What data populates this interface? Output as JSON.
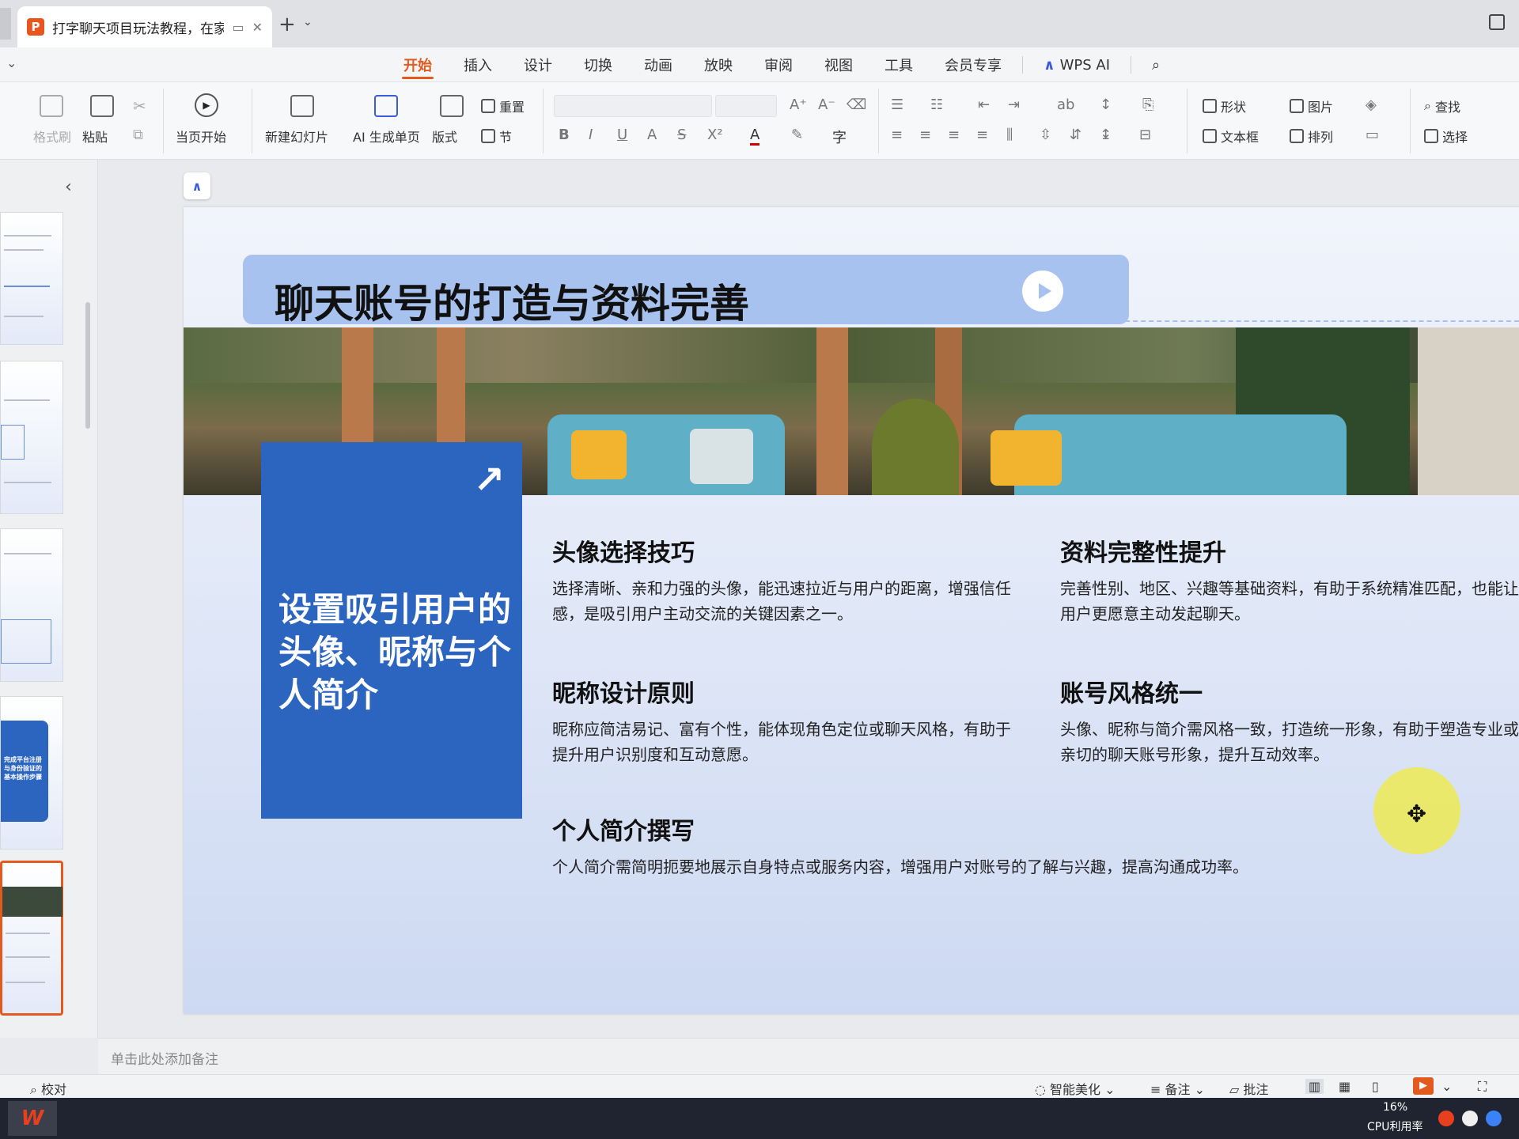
{
  "tabbar": {
    "doc_title": "打字聊天项目玩法教程，在家",
    "app_icon_letter": "P",
    "new_tab": "+"
  },
  "menu": {
    "tabs": [
      "开始",
      "插入",
      "设计",
      "切换",
      "动画",
      "放映",
      "审阅",
      "视图",
      "工具",
      "会员专享",
      "WPS AI"
    ],
    "active": "开始"
  },
  "ribbon": {
    "format_painter": "格式刷",
    "paste": "粘贴",
    "from_current": "当页开始",
    "new_slide": "新建幻灯片",
    "ai_page": "AI 生成单页",
    "layout": "版式",
    "reset": "重置",
    "section": "节",
    "shape": "形状",
    "picture": "图片",
    "textbox": "文本框",
    "arrange": "排列",
    "find": "查找",
    "select": "选择"
  },
  "slide": {
    "title": "聊天账号的打造与资料完善",
    "box_text": "设置吸引用户的头像、昵称与个人简介",
    "sections": [
      {
        "heading": "头像选择技巧",
        "body": "选择清晰、亲和力强的头像，能迅速拉近与用户的距离，增强信任感，是吸引用户主动交流的关键因素之一。"
      },
      {
        "heading": "资料完整性提升",
        "body": "完善性别、地区、兴趣等基础资料，有助于系统精准匹配，也能让用户更愿意主动发起聊天。"
      },
      {
        "heading": "昵称设计原则",
        "body": "昵称应简洁易记、富有个性，能体现角色定位或聊天风格，有助于提升用户识别度和互动意愿。"
      },
      {
        "heading": "账号风格统一",
        "body": "头像、昵称与简介需风格一致，打造统一形象，有助于塑造专业或亲切的聊天账号形象，提升互动效率。"
      },
      {
        "heading": "个人简介撰写",
        "body": "个人简介需简明扼要地展示自身特点或服务内容，增强用户对账号的了解与兴趣，提高沟通成功率。"
      }
    ]
  },
  "thumb_box_text": "完成平台注册与身份验证的基本操作步骤",
  "notes_placeholder": "单击此处添加备注",
  "status": {
    "proofread": "校对",
    "beautify": "智能美化",
    "notes": "备注",
    "comments": "批注"
  },
  "taskbar": {
    "cpu_percent": "16%",
    "cpu_label": "CPU利用率"
  },
  "colors": {
    "accent": "#e35a1f",
    "slide_blue": "#2c65c0",
    "banner": "#a7c2ee"
  },
  "icons": [
    "play-icon",
    "arrow-up-right-icon",
    "search-icon",
    "cursor-move-icon"
  ]
}
